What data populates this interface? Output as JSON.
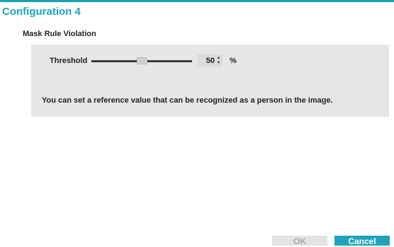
{
  "dialog": {
    "title": "Configuration 4"
  },
  "section": {
    "title": "Mask Rule Violation"
  },
  "threshold": {
    "label": "Threshold",
    "value": "50",
    "unit": "%",
    "slider_fraction": 0.5,
    "up_glyph": "▲",
    "down_glyph": "▼"
  },
  "description": "You can set a reference value that can be recognized as a person in the image.",
  "buttons": {
    "ok_label": "OK",
    "cancel_label": "Cancel"
  },
  "colors": {
    "accent": "#1ea3ba",
    "title": "#19a7c2",
    "panel": "#e6e6e6"
  }
}
